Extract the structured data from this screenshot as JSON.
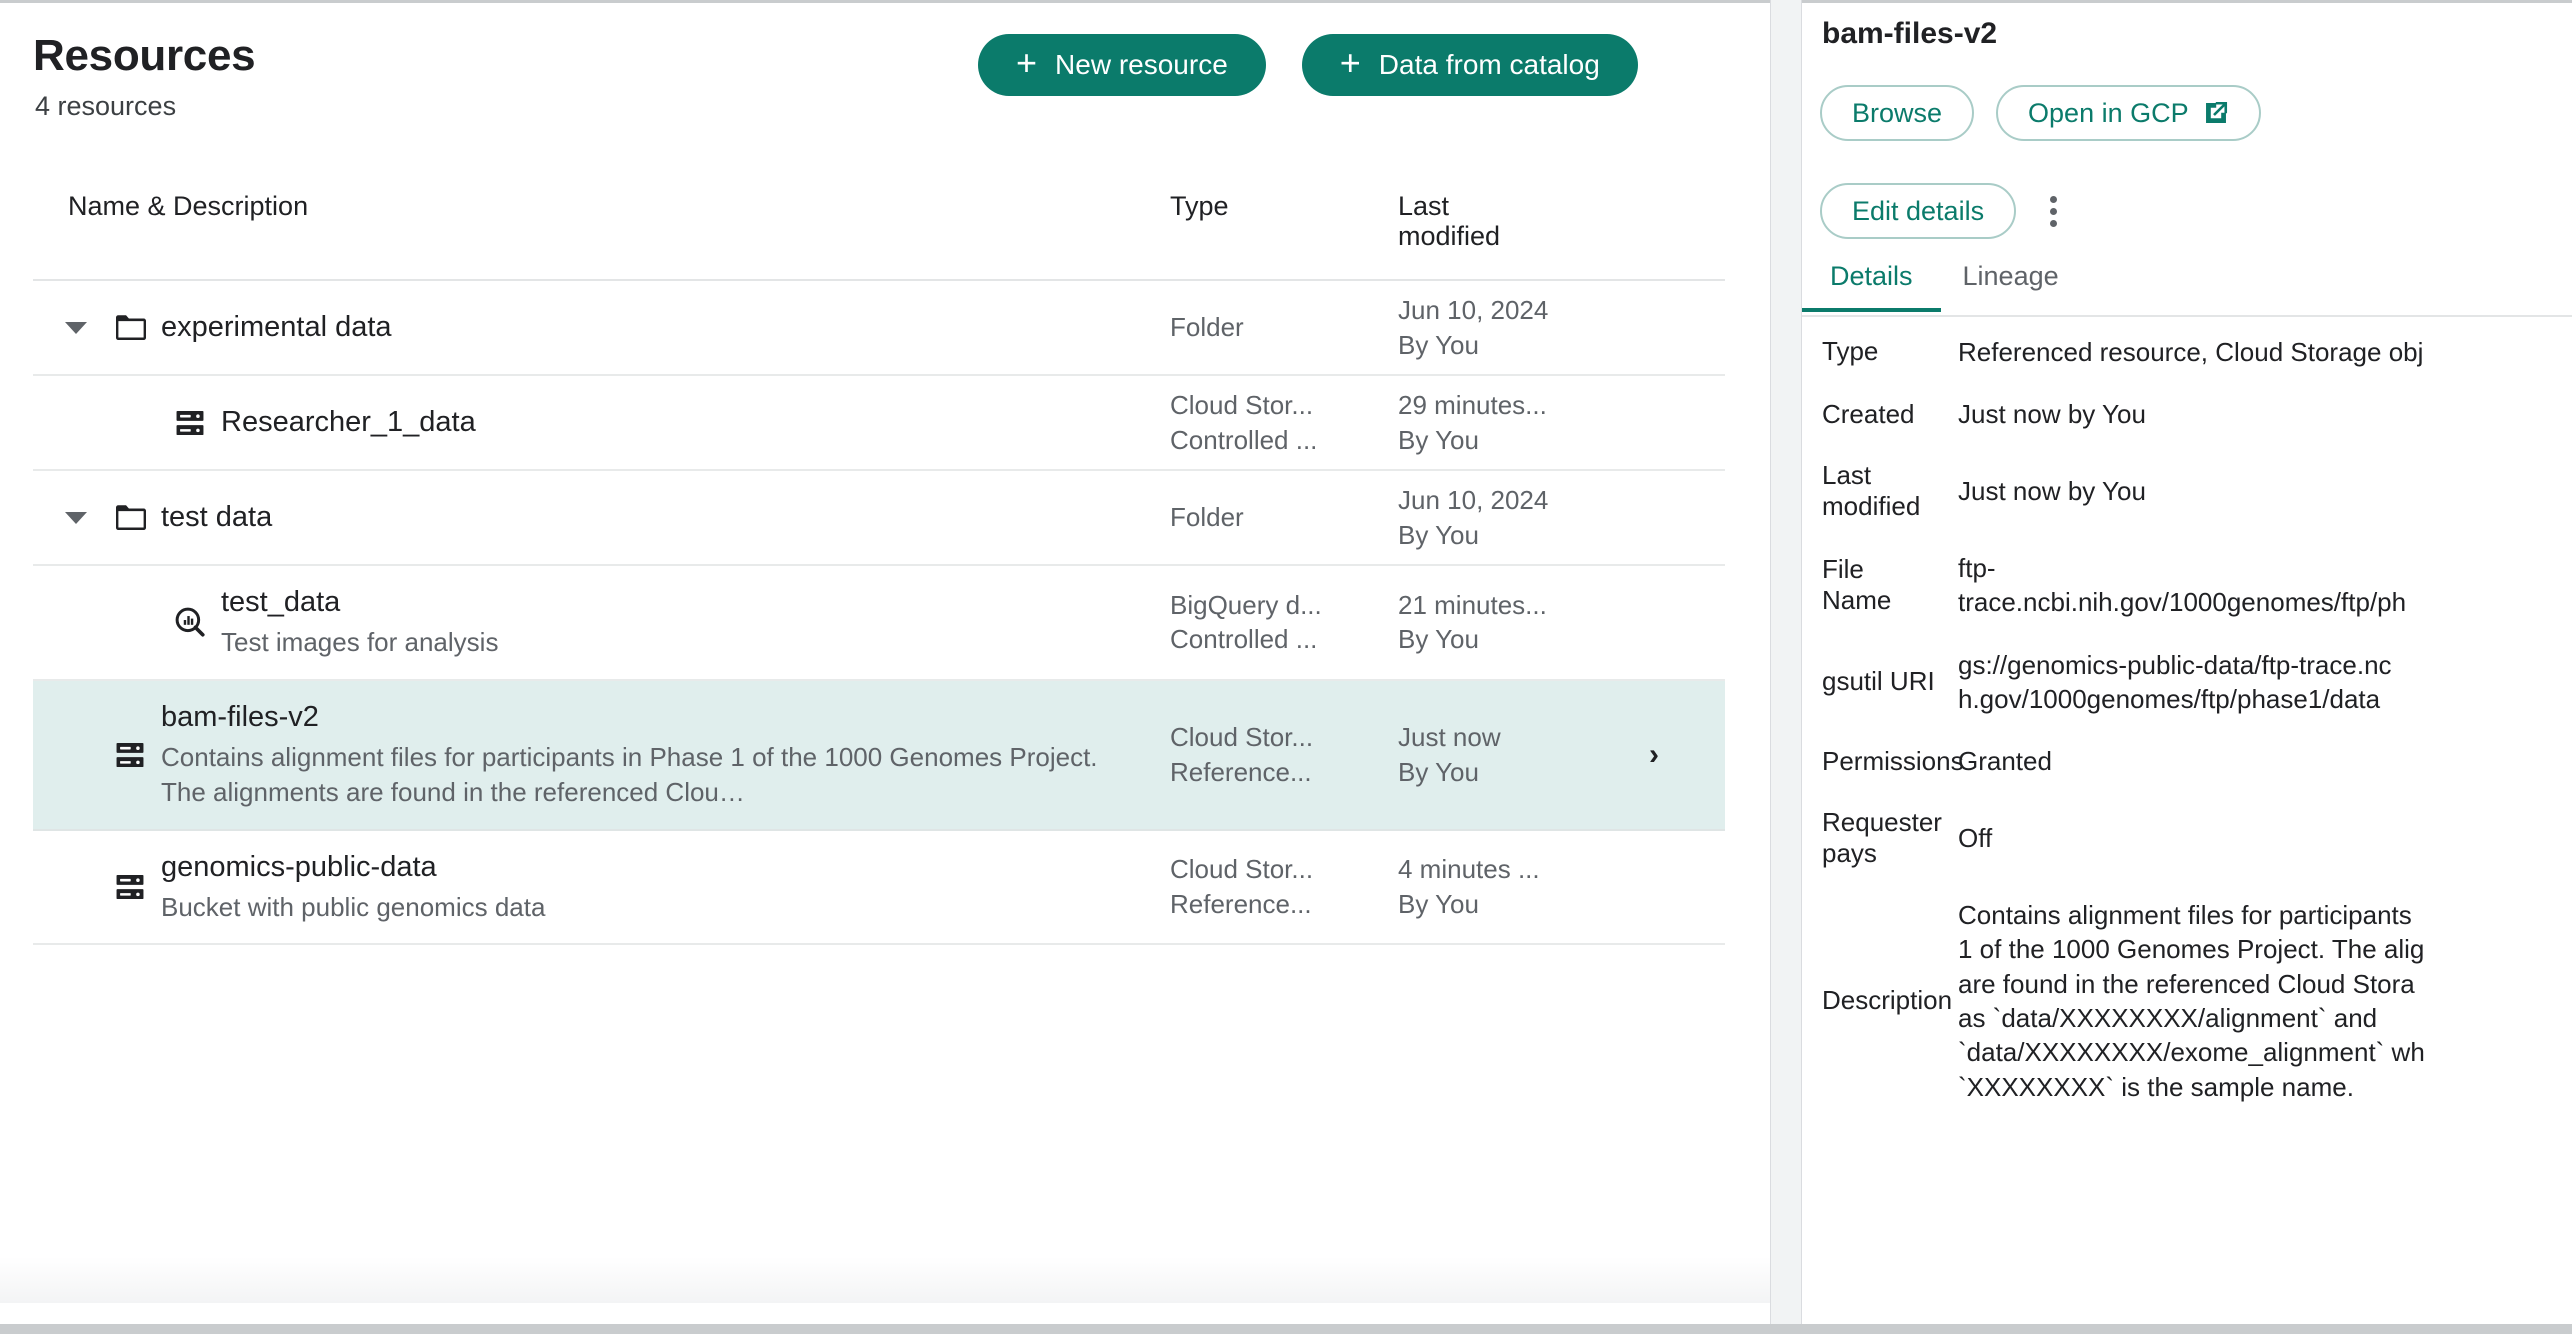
{
  "header": {
    "title": "Resources",
    "subtitle": "4 resources",
    "new_resource_label": "New resource",
    "data_from_catalog_label": "Data from catalog",
    "plus_glyph": "+"
  },
  "table": {
    "columns": {
      "name": "Name & Description",
      "type": "Type",
      "last_modified_line1": "Last",
      "last_modified_line2": "modified"
    },
    "rows": [
      {
        "name": "experimental data",
        "description": "",
        "icon": "folder-icon",
        "indent": "folder",
        "has_caret": true,
        "type_line1": "Folder",
        "type_line2": "",
        "modified_line1": "Jun 10, 2024",
        "modified_line2": "By You",
        "selected": false,
        "has_chevron": false
      },
      {
        "name": "Researcher_1_data",
        "description": "",
        "icon": "cloud-storage-object-icon",
        "indent": "child",
        "has_caret": false,
        "type_line1": "Cloud Stor...",
        "type_line2": "Controlled ...",
        "modified_line1": "29 minutes...",
        "modified_line2": "By You",
        "selected": false,
        "has_chevron": false
      },
      {
        "name": "test data",
        "description": "",
        "icon": "folder-icon",
        "indent": "folder",
        "has_caret": true,
        "type_line1": "Folder",
        "type_line2": "",
        "modified_line1": "Jun 10, 2024",
        "modified_line2": "By You",
        "selected": false,
        "has_chevron": false
      },
      {
        "name": "test_data",
        "description": "Test images for analysis",
        "icon": "bigquery-dataset-icon",
        "indent": "child",
        "has_caret": false,
        "type_line1": "BigQuery d...",
        "type_line2": "Controlled ...",
        "modified_line1": "21 minutes...",
        "modified_line2": "By You",
        "selected": false,
        "has_chevron": false
      },
      {
        "name": "bam-files-v2",
        "description": "Contains alignment files for participants in Phase 1 of the 1000 Genomes Project. The alignments are found in the referenced Clou…",
        "icon": "cloud-storage-object-icon",
        "indent": "root",
        "has_caret": false,
        "type_line1": "Cloud Stor...",
        "type_line2": "Reference...",
        "modified_line1": "Just now",
        "modified_line2": "By You",
        "selected": true,
        "has_chevron": true,
        "chevron_glyph": "›"
      },
      {
        "name": "genomics-public-data",
        "description": "Bucket with public genomics data",
        "icon": "cloud-storage-object-icon",
        "indent": "root",
        "has_caret": false,
        "type_line1": "Cloud Stor...",
        "type_line2": "Reference...",
        "modified_line1": "4 minutes ...",
        "modified_line2": "By You",
        "selected": false,
        "has_chevron": false
      }
    ]
  },
  "detail": {
    "title": "bam-files-v2",
    "browse_label": "Browse",
    "open_in_gcp_label": "Open in GCP",
    "edit_details_label": "Edit details",
    "tabs": [
      {
        "label": "Details",
        "active": true
      },
      {
        "label": "Lineage",
        "active": false
      }
    ],
    "fields": [
      {
        "key": "Type",
        "value": "Referenced resource, Cloud Storage obj"
      },
      {
        "key": "Created",
        "value": "Just now by You"
      },
      {
        "key": "Last\nmodified",
        "value": "Just now by You"
      },
      {
        "key": "File Name",
        "value": "ftp-\ntrace.ncbi.nih.gov/1000genomes/ftp/ph"
      },
      {
        "key": "gsutil URI",
        "value": "gs://genomics-public-data/ftp-trace.nc\nh.gov/1000genomes/ftp/phase1/data"
      },
      {
        "key": "Permissions",
        "value": "Granted"
      },
      {
        "key": "Requester\npays",
        "value": "Off"
      },
      {
        "key": "Description",
        "value": "Contains alignment files for participants\n1 of the 1000 Genomes Project. The alig\nare found in the referenced Cloud Stora\nas `data/XXXXXXXX/alignment` and\n`data/XXXXXXXX/exome_alignment` wh\n`XXXXXXXX` is the sample name."
      }
    ]
  },
  "colors": {
    "accent": "#0b7b6b",
    "selected_row": "#e0eeed",
    "outline_button_border": "#a9ccc7",
    "muted_text": "#5f6368",
    "primary_text": "#202124"
  }
}
